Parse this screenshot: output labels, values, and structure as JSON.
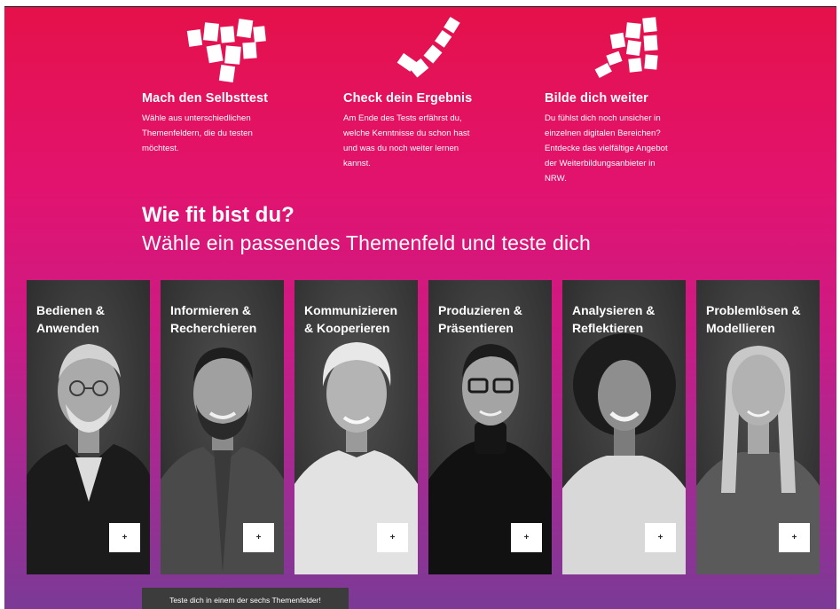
{
  "features": [
    {
      "icon": "puzzle-tiles-icon",
      "title": "Mach den Selbsttest",
      "lines": [
        "Wähle aus unterschiedlichen",
        "Themenfeldern, die du testen",
        "möchtest."
      ]
    },
    {
      "icon": "checkmark-tiles-icon",
      "title": "Check dein Ergebnis",
      "lines": [
        "Am Ende des Tests erfährst du,",
        "welche Kenntnisse du schon hast",
        "und was du noch weiter lernen",
        "kannst."
      ]
    },
    {
      "icon": "rising-tiles-icon",
      "title": "Bilde dich weiter",
      "lines": [
        "Du fühlst dich noch unsicher in",
        "einzelnen digitalen Bereichen?",
        "Entdecke das vielfältige Angebot",
        "der Weiterbildungsanbieter in",
        "NRW."
      ]
    }
  ],
  "heading": {
    "title": "Wie fit bist du?",
    "subtitle": "Wähle ein passendes Themenfeld und teste dich"
  },
  "cards": [
    {
      "line1": "Bedienen &",
      "line2": "Anwenden",
      "button": "+"
    },
    {
      "line1": "Informieren &",
      "line2": "Recherchieren",
      "button": "+"
    },
    {
      "line1": "Kommunizieren",
      "line2": "& Kooperieren",
      "button": "+"
    },
    {
      "line1": "Produzieren &",
      "line2": "Präsentieren",
      "button": "+"
    },
    {
      "line1": "Analysieren &",
      "line2": "Reflektieren",
      "button": "+"
    },
    {
      "line1": "Problemlösen &",
      "line2": "Modellieren",
      "button": "+"
    }
  ],
  "cta": {
    "label": "Teste dich in einem der sechs Themenfelder!"
  },
  "colors": {
    "gradient_top": "#e5114a",
    "gradient_mid": "#e2136f",
    "gradient_bottom": "#7b3a96",
    "card_bg": "#2f2f2f"
  }
}
